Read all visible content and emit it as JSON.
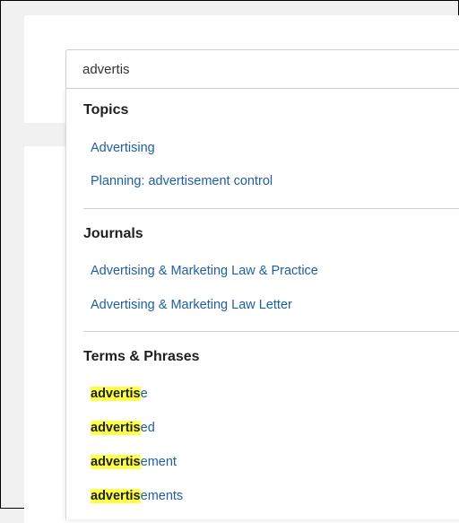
{
  "search": {
    "value": "advertis"
  },
  "topics": {
    "heading": "Topics",
    "items": [
      "Advertising",
      "Planning: advertisement control"
    ]
  },
  "journals": {
    "heading": "Journals",
    "items": [
      "Advertising & Marketing Law & Practice",
      "Advertising & Marketing Law Letter"
    ]
  },
  "terms": {
    "heading": "Terms & Phrases",
    "items": [
      {
        "match": "advertis",
        "rest": "e"
      },
      {
        "match": "advertis",
        "rest": "ed"
      },
      {
        "match": "advertis",
        "rest": "ement"
      },
      {
        "match": "advertis",
        "rest": "ements"
      }
    ]
  },
  "colors": {
    "link": "#1f5fa0",
    "highlight": "#ffff44"
  }
}
